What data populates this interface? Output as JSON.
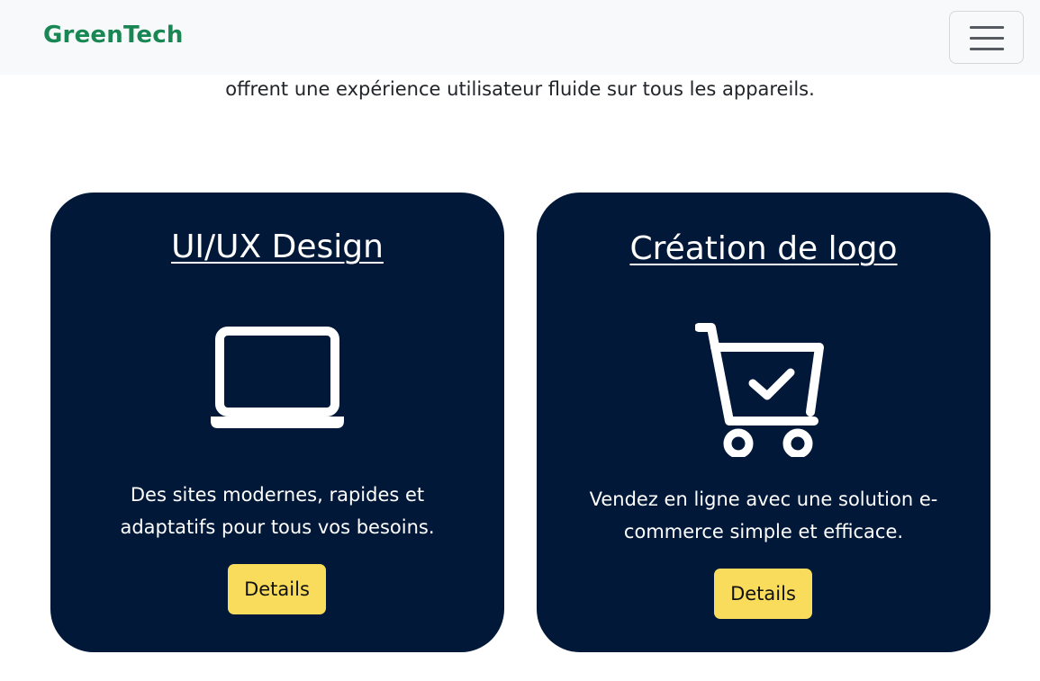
{
  "navbar": {
    "brand": "GreenTech",
    "toggler_icon": "hamburger-menu-icon"
  },
  "intro": {
    "text": "offrent une expérience utilisateur fluide sur tous les appareils."
  },
  "cards": [
    {
      "title": "UI/UX Design",
      "icon": "laptop-icon",
      "description": "Des sites modernes, rapides et adaptatifs pour tous vos besoins.",
      "button_label": "Details"
    },
    {
      "title": "Création de logo",
      "icon": "shopping-cart-check-icon",
      "description": "Vendez en ligne avec une solution e-commerce simple et efficace.",
      "button_label": "Details"
    }
  ],
  "colors": {
    "brand": "#198754",
    "navbar_bg": "#f8f9fa",
    "card_bg": "#011839",
    "button_bg": "#f9dc5c"
  }
}
